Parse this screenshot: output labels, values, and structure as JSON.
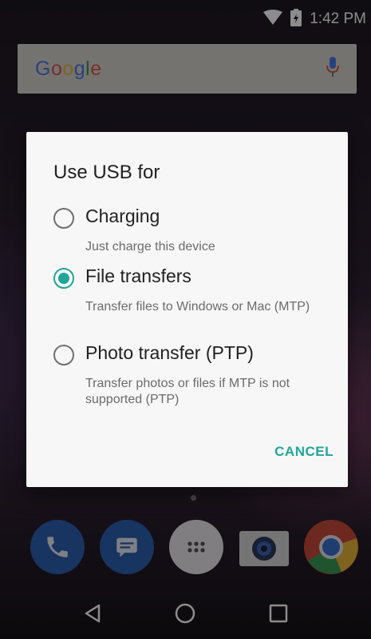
{
  "status_bar": {
    "time": "1:42 PM",
    "icons": [
      "wifi-icon",
      "battery-icon"
    ]
  },
  "search_bar": {
    "logo_letters": [
      "G",
      "o",
      "o",
      "g",
      "l",
      "e"
    ],
    "logo_colors": [
      "#4a7be0",
      "#d9574a",
      "#e6b43a",
      "#4a7be0",
      "#3a9a56",
      "#d9574a"
    ],
    "mic_icon": "mic-icon"
  },
  "dialog": {
    "title": "Use USB for",
    "options": [
      {
        "label": "Charging",
        "description": "Just charge this device",
        "selected": false
      },
      {
        "label": "File transfers",
        "description": "Transfer files to Windows or Mac (MTP)",
        "selected": true
      },
      {
        "label": "Photo transfer (PTP)",
        "description": "Transfer photos or files if MTP is not supported (PTP)",
        "selected": false
      }
    ],
    "cancel_label": "CANCEL",
    "accent_color": "#1fa69a"
  },
  "dock": {
    "apps": [
      {
        "name": "phone-icon",
        "color": "#2c5fb0"
      },
      {
        "name": "messages-icon",
        "color": "#2c5fb0"
      },
      {
        "name": "app-drawer-icon",
        "color": "#e9e6ea"
      },
      {
        "name": "camera-icon",
        "color": "#d8d5d8"
      },
      {
        "name": "chrome-icon",
        "color": "#c64a3a"
      }
    ]
  },
  "nav_bar": {
    "buttons": [
      "back-icon",
      "home-icon",
      "recents-icon"
    ]
  }
}
